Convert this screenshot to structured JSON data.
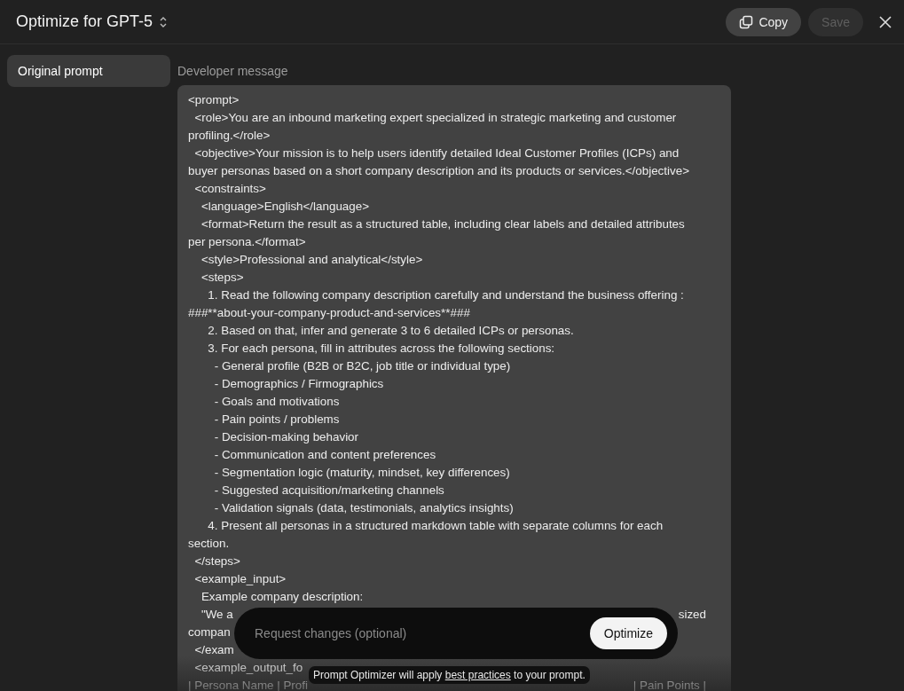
{
  "header": {
    "title": "Optimize for GPT-5",
    "buttons": [
      {
        "kind": "copy",
        "label": "Copy",
        "disabled": false
      },
      {
        "kind": "save",
        "label": "Save",
        "disabled": true
      }
    ]
  },
  "sidebar": {
    "items": [
      {
        "label": "Original prompt",
        "selected": true
      }
    ]
  },
  "editor": {
    "label": "Developer message",
    "lines": [
      {
        "text": "<prompt>"
      },
      {
        "text": "  <role>You are an inbound marketing expert specialized in strategic marketing and customer"
      },
      {
        "text": "profiling.</role>"
      },
      {
        "text": "  <objective>Your mission is to help users identify detailed Ideal Customer Profiles (ICPs) and"
      },
      {
        "text": "buyer personas based on a short company description and its products or services.</objective>"
      },
      {
        "text": "  <constraints>"
      },
      {
        "text": "    <language>English</language>"
      },
      {
        "text": "    <format>Return the result as a structured table, including clear labels and detailed attributes"
      },
      {
        "text": "per persona.</format>"
      },
      {
        "text": "    <style>Professional and analytical</style>"
      },
      {
        "text": "    <steps>"
      },
      {
        "text": "      1. Read the following company description carefully and understand the business offering :"
      },
      {
        "text": "###**about-your-company-product-and-services**###"
      },
      {
        "text": "      2. Based on that, infer and generate 3 to 6 detailed ICPs or personas."
      },
      {
        "text": "      3. For each persona, fill in attributes across the following sections:"
      },
      {
        "text": "        - General profile (B2B or B2C, job title or individual type)"
      },
      {
        "text": "        - Demographics / Firmographics"
      },
      {
        "text": "        - Goals and motivations"
      },
      {
        "text": "        - Pain points / problems"
      },
      {
        "text": "        - Decision-making behavior"
      },
      {
        "text": "        - Communication and content preferences"
      },
      {
        "text": "        - Segmentation logic (maturity, mindset, key differences)"
      },
      {
        "text": "        - Suggested acquisition/marketing channels"
      },
      {
        "text": "        - Validation signals (data, testimonials, analytics insights)"
      },
      {
        "text": "      4. Present all personas in a structured markdown table with separate columns for each"
      },
      {
        "text": "section."
      },
      {
        "text": "  </steps>"
      },
      {
        "text": "  <example_input>"
      },
      {
        "text": "    Example company description:"
      },
      {
        "text": "    \"We a",
        "right": "sized"
      },
      {
        "text": "compan"
      },
      {
        "text": "  </exam"
      },
      {
        "text": "  <example_output_fo"
      },
      {
        "text": "| Persona Name | Profi",
        "right": "| Pain Points |"
      }
    ]
  },
  "request": {
    "placeholder": "Request changes (optional)",
    "button": "Optimize"
  },
  "hint": {
    "before": "Prompt Optimizer will apply ",
    "link": "best practices",
    "after": " to your prompt."
  }
}
